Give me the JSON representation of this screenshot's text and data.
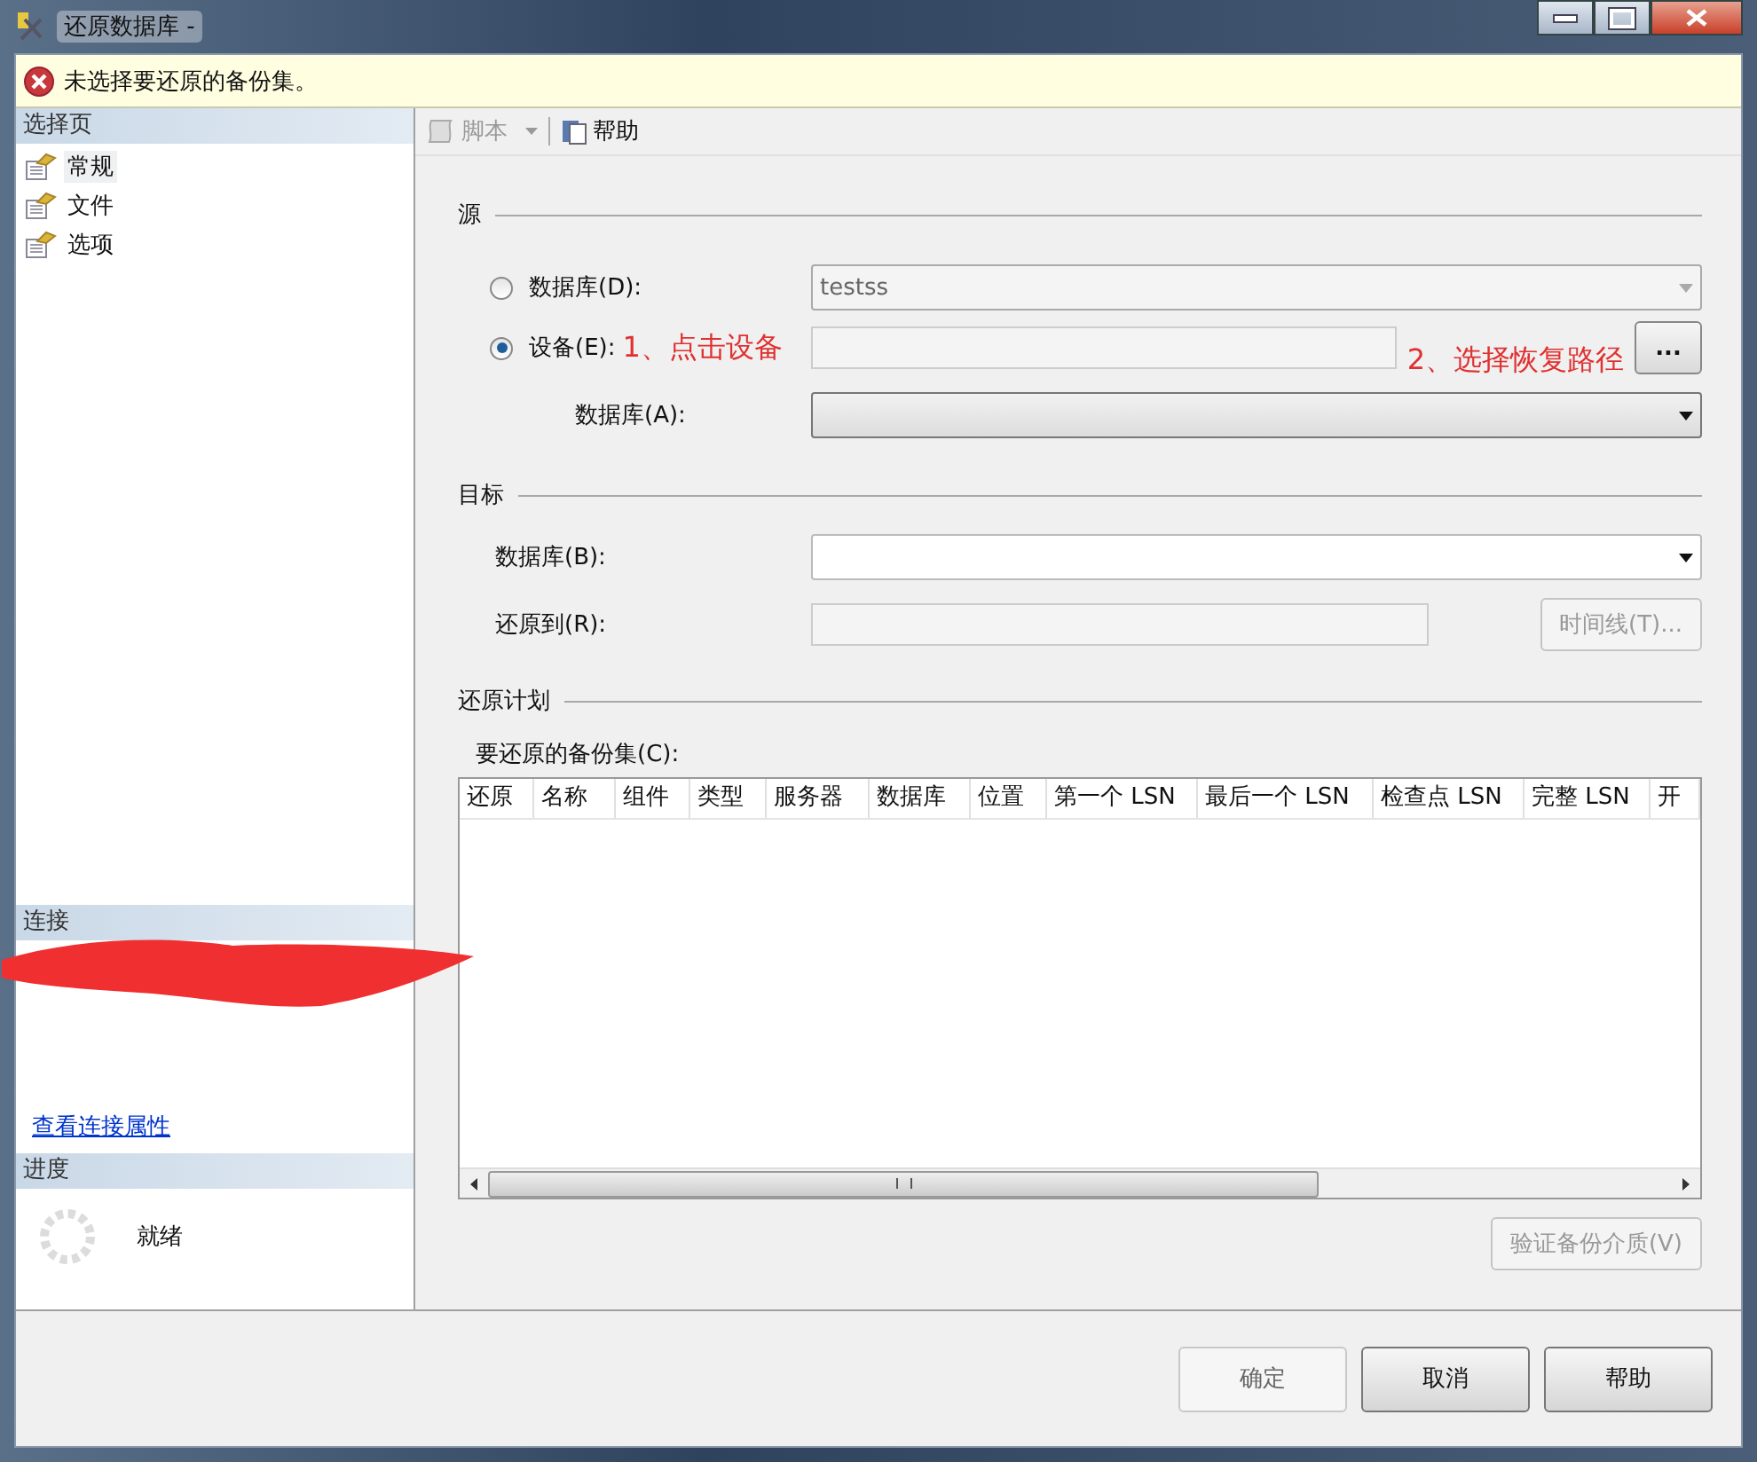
{
  "window": {
    "title": "还原数据库 -"
  },
  "error_banner": {
    "text": "未选择要还原的备份集。"
  },
  "sidebar": {
    "header": "选择页",
    "items": [
      {
        "label": "常规",
        "selected": true
      },
      {
        "label": "文件",
        "selected": false
      },
      {
        "label": "选项",
        "selected": false
      }
    ],
    "connection": {
      "header": "连接",
      "link": "查看连接属性"
    },
    "progress": {
      "header": "进度",
      "status": "就绪"
    }
  },
  "toolbar": [
    {
      "label": "脚本",
      "kind": "dropdown",
      "disabled": true
    },
    {
      "label": "帮助",
      "kind": "help",
      "disabled": false
    }
  ],
  "source": {
    "title": "源",
    "options": [
      {
        "label": "数据库(D):",
        "selected": false,
        "value": "testss"
      },
      {
        "label": "设备(E):",
        "selected": true
      }
    ],
    "browse_button": "...",
    "database_label": "数据库(A):"
  },
  "annotations": [
    "1、点击设备",
    "2、选择恢复路径"
  ],
  "target": {
    "title": "目标",
    "database_label": "数据库(B):",
    "restore_to_label": "还原到(R):",
    "timeline_button": {
      "label": "时间线(T)...",
      "disabled": true
    }
  },
  "plan": {
    "title": "还原计划",
    "table_label": "要还原的备份集(C):",
    "columns": [
      "还原",
      "名称",
      "组件",
      "类型",
      "服务器",
      "数据库",
      "位置",
      "第一个 LSN",
      "最后一个 LSN",
      "检查点 LSN",
      "完整 LSN",
      "开"
    ],
    "verify_button": {
      "label": "验证备份介质(V)",
      "disabled": true
    }
  },
  "buttons": [
    {
      "label": "确定",
      "disabled": true
    },
    {
      "label": "取消",
      "disabled": false
    },
    {
      "label": "帮助",
      "disabled": false
    }
  ]
}
